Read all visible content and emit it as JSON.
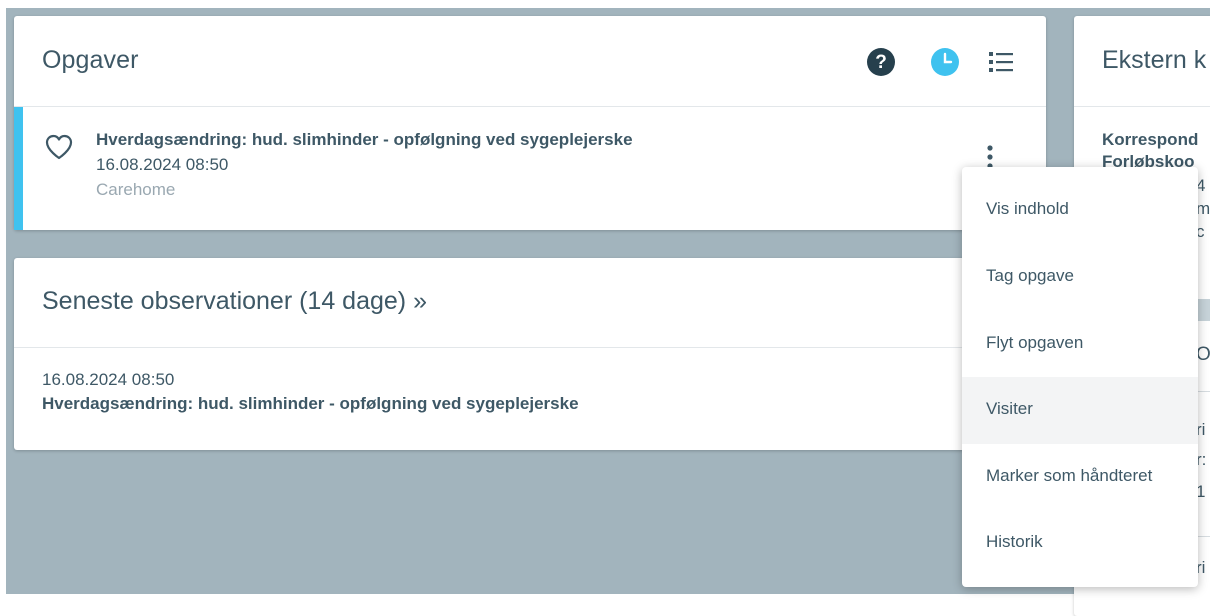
{
  "tasks_panel": {
    "title": "Opgaver",
    "icons": [
      "help-icon",
      "clock-icon",
      "list-icon"
    ],
    "accent_color": "#3fc2ef",
    "task": {
      "icon": "heart-icon",
      "title": "Hverdagsændring: hud. slimhinder - opfølgning ved sygeplejerske",
      "date": "16.08.2024 08:50",
      "location": "Carehome"
    }
  },
  "observations_panel": {
    "title": "Seneste observationer (14 dage) »",
    "entry": {
      "date": "16.08.2024 08:50",
      "text": "Hverdagsændring: hud. slimhinder - opfølgning ved sygeplejerske"
    }
  },
  "external_panel": {
    "title": "Ekstern k",
    "lines": [
      "Korrespond",
      "Forløbskoo",
      "4",
      "m",
      "c",
      "O",
      "ri",
      "r:",
      "1",
      "ri"
    ]
  },
  "context_menu": {
    "items": [
      {
        "label": "Vis indhold"
      },
      {
        "label": "Tag opgave"
      },
      {
        "label": "Flyt opgaven"
      },
      {
        "label": "Visiter",
        "hovered": true
      },
      {
        "label": "Marker som håndteret"
      },
      {
        "label": "Historik"
      }
    ]
  }
}
